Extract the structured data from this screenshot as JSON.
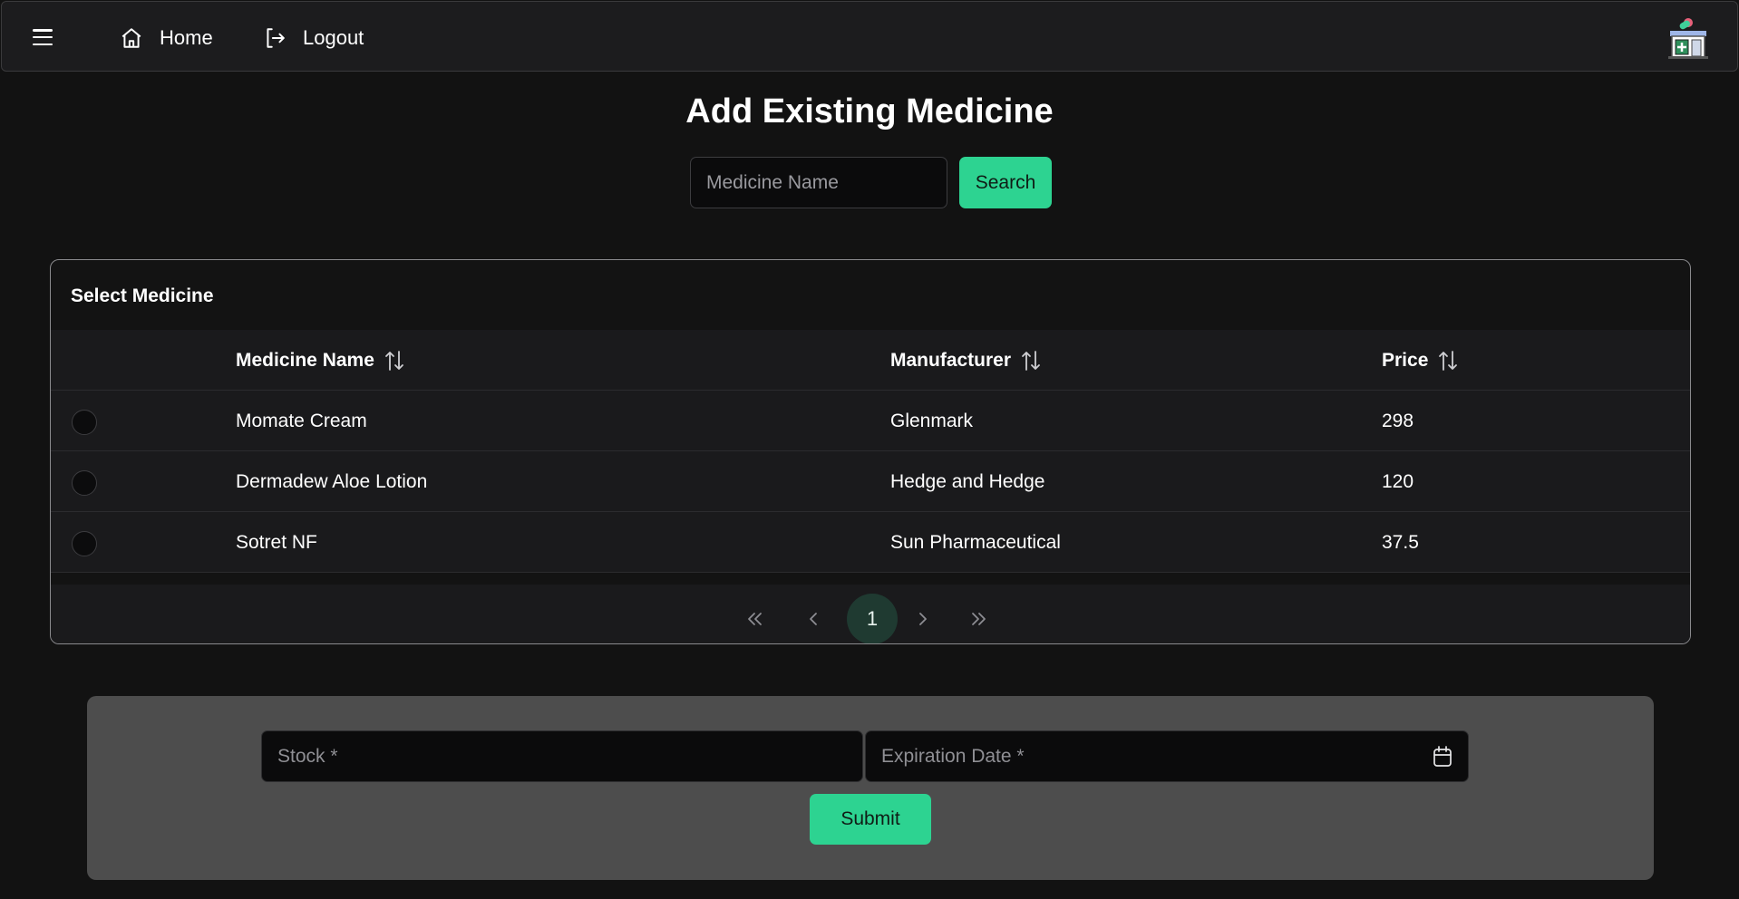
{
  "nav": {
    "home_label": "Home",
    "logout_label": "Logout"
  },
  "page": {
    "title": "Add Existing Medicine"
  },
  "search": {
    "placeholder": "Medicine Name",
    "value": "",
    "button_label": "Search"
  },
  "table": {
    "caption": "Select Medicine",
    "columns": [
      "Medicine Name",
      "Manufacturer",
      "Price"
    ],
    "rows": [
      {
        "name": "Momate Cream",
        "manufacturer": "Glenmark",
        "price": "298",
        "selected": false
      },
      {
        "name": "Dermadew Aloe Lotion",
        "manufacturer": "Hedge and Hedge",
        "price": "120",
        "selected": false
      },
      {
        "name": "Sotret NF",
        "manufacturer": "Sun Pharmaceutical",
        "price": "37.5",
        "selected": false
      }
    ],
    "pagination": {
      "first": "«",
      "prev": "‹",
      "current_page": "1",
      "next": "›",
      "last": "»"
    }
  },
  "form": {
    "stock_placeholder": "Stock *",
    "expiration_placeholder": "Expiration Date *",
    "submit_label": "Submit"
  },
  "colors": {
    "accent": "#2dd391",
    "background": "#121212",
    "navbar": "#1c1c1e",
    "form_panel": "#4d4d4d"
  },
  "icons": {
    "menu": "hamburger-icon",
    "home": "home-icon",
    "logout": "logout-icon",
    "sort": "sort-icon",
    "calendar": "calendar-icon",
    "logo": "pharmacy-logo"
  }
}
